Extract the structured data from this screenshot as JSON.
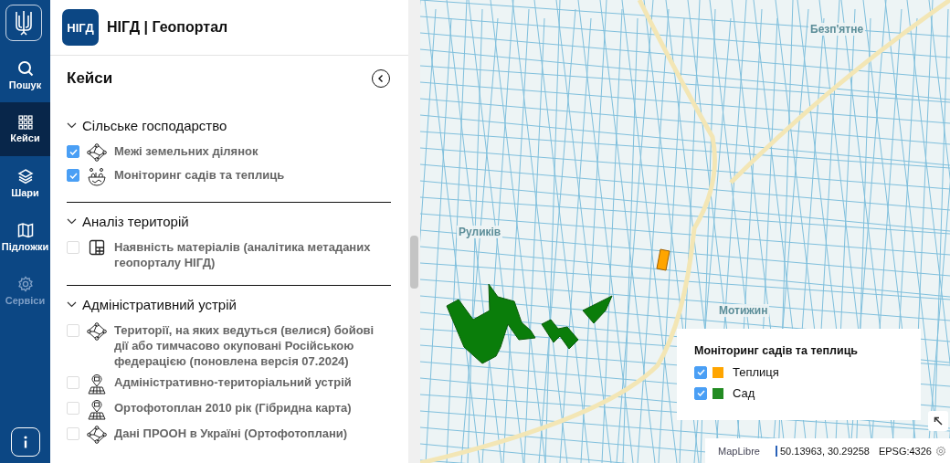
{
  "rail": {
    "items": [
      {
        "label": "Пошук",
        "kind": "search",
        "selected": false,
        "disabled": false
      },
      {
        "label": "Кейси",
        "kind": "grid",
        "selected": true,
        "disabled": false
      },
      {
        "label": "Шари",
        "kind": "layers",
        "selected": false,
        "disabled": false
      },
      {
        "label": "Підложки",
        "kind": "map",
        "selected": false,
        "disabled": false
      },
      {
        "label": "Сервіси",
        "kind": "gear",
        "selected": false,
        "disabled": true
      }
    ]
  },
  "panel": {
    "logo": "НІГД",
    "title": "НІГД | Геопортал",
    "heading": "Кейси",
    "sections": [
      {
        "title": "Сільське господарство",
        "expanded": true,
        "items": [
          {
            "label": "Межі земельних ділянок",
            "kind": "network",
            "checked": true
          },
          {
            "label": "Моніторинг садів та теплиць",
            "kind": "bowl",
            "checked": true
          }
        ]
      },
      {
        "title": "Аналіз територій",
        "expanded": true,
        "items": [
          {
            "label": "Наявність матеріалів (аналітика метаданих геопорталу НІГД)",
            "kind": "layout",
            "checked": false
          }
        ]
      },
      {
        "title": "Адміністративний устрій",
        "expanded": true,
        "items": [
          {
            "label": "Території, на яких ведуться (велися) бойові дії або тимчасово окуповані Російською федерацією (поновлена версія 07.2024)",
            "kind": "network",
            "checked": false
          },
          {
            "label": "Адміністративно-територіальний устрій",
            "kind": "pin",
            "checked": false
          },
          {
            "label": "Ортофотоплан 2010 рік (Гібридна карта)",
            "kind": "pin",
            "checked": false
          },
          {
            "label": "Дані ПРООН в Україні (Ортофотоплани)",
            "kind": "network",
            "checked": false
          }
        ]
      }
    ]
  },
  "map": {
    "labels": [
      "Безп'ятне",
      "Руликів",
      "Мотижин"
    ],
    "legend": {
      "title": "Моніторинг садів та теплиць",
      "items": [
        {
          "label": "Теплиця",
          "checked": true,
          "color": "#ffa500"
        },
        {
          "label": "Сад",
          "checked": true,
          "color": "#228b22"
        }
      ]
    },
    "attribution": "MapLibre",
    "coordinates": "50.13963, 30.29258",
    "projection": "EPSG:4326"
  }
}
